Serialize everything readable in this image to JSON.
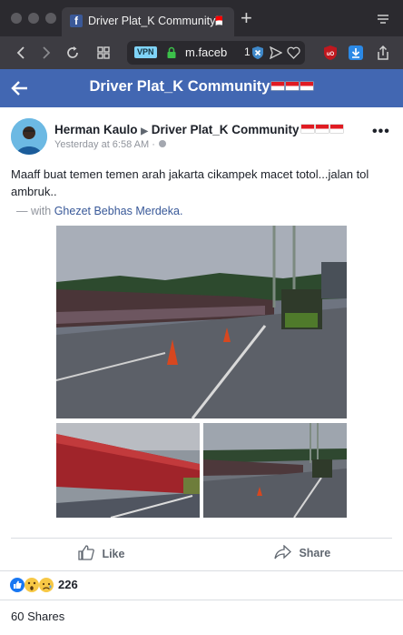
{
  "browser": {
    "tab_title": "Driver Plat_K Community🇮🇩",
    "tab_favicon": "f",
    "new_tab": "+",
    "vpn_badge": "VPN",
    "url": "m.faceb",
    "tab_count": "1"
  },
  "header": {
    "back": "←",
    "title": "Driver Plat_K Community"
  },
  "post": {
    "author": "Herman Kaulo",
    "group": "Driver Plat_K Community",
    "timestamp": "Yesterday at 6:58 AM ·",
    "body": "Maaff buat temen temen arah jakarta cikampek macet totol...jalan tol ambruk..",
    "with_prefix": "— with",
    "tagged": "Ghezet Bebhas Merdeka.",
    "more": "•••"
  },
  "actions": {
    "like": "Like",
    "share": "Share"
  },
  "footer": {
    "reaction_count": "226",
    "shares": "60 Shares"
  },
  "colors": {
    "brand": "#4267b2",
    "link": "#385898"
  }
}
